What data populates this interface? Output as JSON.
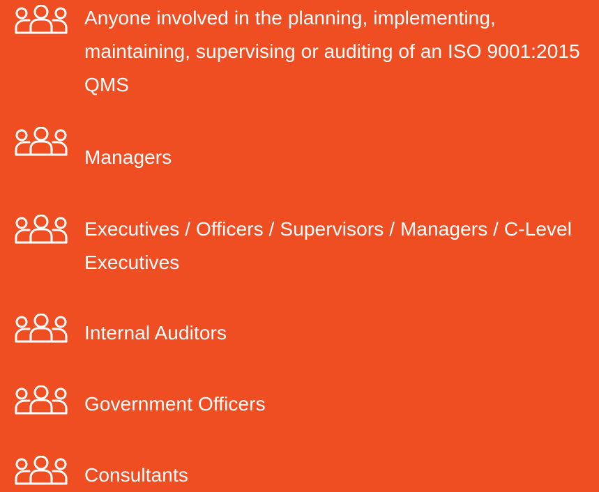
{
  "colors": {
    "background": "#ef4e23",
    "text": "#ffffff"
  },
  "audience": {
    "items": [
      {
        "label": "Anyone involved in the planning, implementing, maintaining, supervising or auditing of an ISO 9001:2015 QMS",
        "icon": "group-icon"
      },
      {
        "label": "Managers",
        "icon": "group-icon"
      },
      {
        "label": "Executives / Officers / Supervisors / Managers / C-Level Executives",
        "icon": "group-icon"
      },
      {
        "label": "Internal Auditors",
        "icon": "group-icon"
      },
      {
        "label": "Government Officers",
        "icon": "group-icon"
      },
      {
        "label": "Consultants",
        "icon": "group-icon"
      }
    ]
  }
}
